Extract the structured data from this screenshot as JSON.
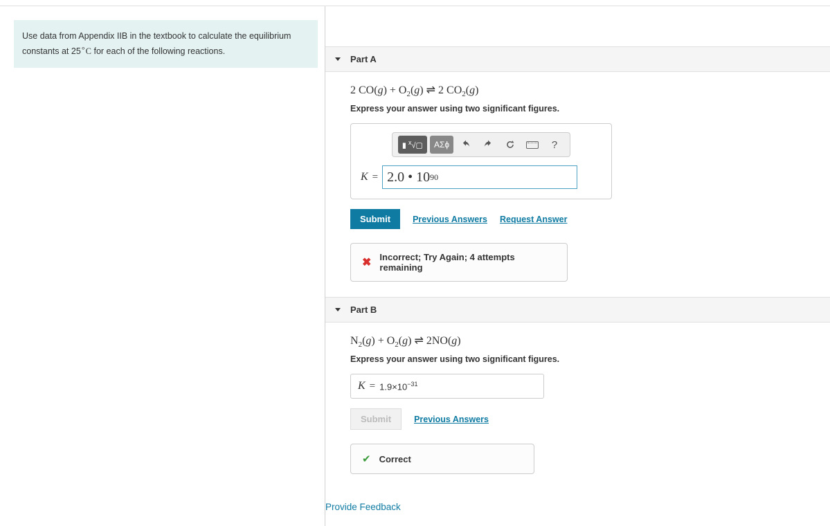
{
  "instructions": {
    "text_before": "Use data from Appendix IIB in the textbook to calculate the equilibrium constants at 25",
    "degree": "∘",
    "unit": "C",
    "text_after": " for each of the following reactions."
  },
  "partA": {
    "title": "Part A",
    "equation_html": "2 CO(g) + O₂(g) ⇌ 2 CO₂(g)",
    "instruction": "Express your answer using two significant figures.",
    "toolbar": {
      "templates_label": "▮ √□",
      "greek_label": "ΑΣϕ",
      "help_label": "?"
    },
    "k_label": "K",
    "eq": "=",
    "answer_value": "2.0 • 10",
    "answer_exp": "90",
    "submit_label": "Submit",
    "prev_answers_label": "Previous Answers",
    "request_answer_label": "Request Answer",
    "feedback_text": "Incorrect; Try Again; 4 attempts remaining"
  },
  "partB": {
    "title": "Part B",
    "equation_html": "N₂(g) + O₂(g) ⇌ 2NO(g)",
    "instruction": "Express your answer using two significant figures.",
    "k_label": "K",
    "eq": "=",
    "answer_value": "1.9×10",
    "answer_exp": "−31",
    "submit_label": "Submit",
    "prev_answers_label": "Previous Answers",
    "feedback_text": "Correct"
  },
  "provide_feedback_label": "Provide Feedback"
}
